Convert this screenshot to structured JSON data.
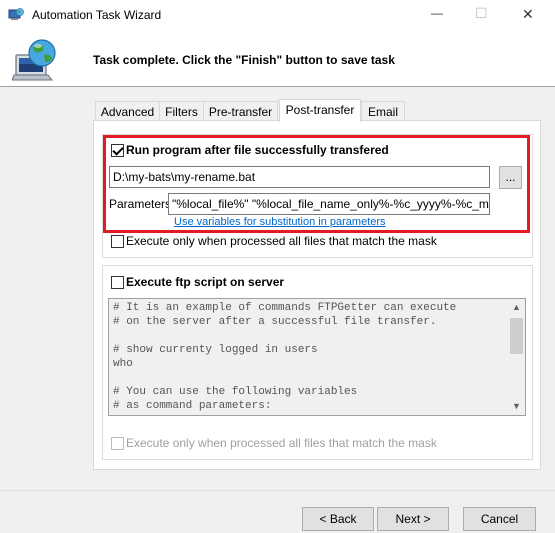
{
  "window": {
    "title": "Automation Task Wizard",
    "minimize_glyph": "—",
    "maximize_glyph": "☐",
    "close_glyph": "✕"
  },
  "header": {
    "message": "Task complete. Click the \"Finish\" button to save task",
    "icon": "computer-globe-icon"
  },
  "tabs": [
    {
      "label": "Advanced",
      "active": false
    },
    {
      "label": "Filters",
      "active": false
    },
    {
      "label": "Pre-transfer",
      "active": false
    },
    {
      "label": "Post-transfer",
      "active": true
    },
    {
      "label": "Email",
      "active": false
    }
  ],
  "run_program": {
    "checkbox_label": "Run program after file successfully transfered",
    "checked": true,
    "path_value": "D:\\my-bats\\my-rename.bat",
    "browse_label": "...",
    "parameters_label": "Parameters",
    "parameters_value": "\"%local_file%\" \"%local_file_name_only%-%c_yyyy%-%c_mm%\"",
    "variables_link": "Use variables for substitution in parameters",
    "only_when_all_label": "Execute only when processed all files that match the mask",
    "only_when_all_checked": false
  },
  "ftp_script": {
    "checkbox_label": "Execute ftp script on server",
    "checked": false,
    "script_text": "# It is an example of commands FTPGetter can execute\n# on the server after a successful file transfer.\n\n# show currenty logged in users\nwho\n\n# You can use the following variables\n# as command parameters:",
    "only_when_all_label": "Execute only when processed all files that match the mask",
    "only_when_all_checked": false
  },
  "buttons": {
    "back": "< Back",
    "next": "Next >",
    "cancel": "Cancel"
  },
  "colors": {
    "highlight_border": "#e01b24",
    "link": "#0066cc"
  }
}
